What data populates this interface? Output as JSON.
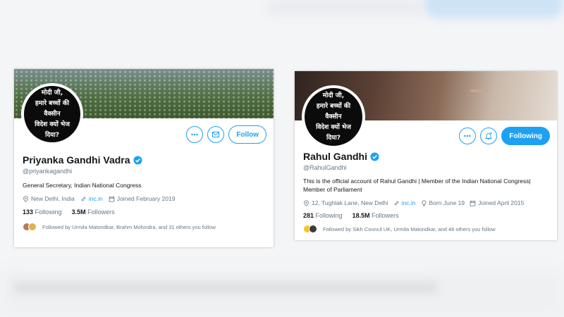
{
  "avatar_text_lines": [
    "मोदी जी,",
    "हमारे बच्चों की वैक्सीन",
    "विदेश क्यों भेज दिया?"
  ],
  "profiles": [
    {
      "name": "Priyanka Gandhi Vadra",
      "handle": "@priyankagandhi",
      "bio": "General Secretary, Indian National Congress",
      "location": "New Delhi, India",
      "link": "inc.in",
      "joined": "Joined February 2019",
      "following_count": "133",
      "following_label": "Following",
      "followers_count": "3.5M",
      "followers_label": "Followers",
      "followed_by": "Followed by Urmila Matondkar, Brahm Mohindra, and 31 others you follow",
      "button_label": "Follow"
    },
    {
      "name": "Rahul Gandhi",
      "handle": "@RahulGandhi",
      "bio": "This is the official account of Rahul Gandhi | Member of the Indian National Congress| Member of Parliament",
      "location": "12, Tughlak Lane, New Delhi",
      "link": "inc.in",
      "born": "Born June 19",
      "joined": "Joined April 2015",
      "following_count": "281",
      "following_label": "Following",
      "followers_count": "18.5M",
      "followers_label": "Followers",
      "followed_by": "Followed by Sikh Council UK, Urmila Matondkar, and 48 others you follow",
      "button_label": "Following"
    }
  ],
  "colors": {
    "accent": "#1da1f2",
    "muted": "#657786",
    "text": "#14171a"
  },
  "icons": [
    "more-icon",
    "mail-icon",
    "bell-plus-icon",
    "verified-icon",
    "location-icon",
    "link-icon",
    "balloon-icon",
    "calendar-icon"
  ]
}
